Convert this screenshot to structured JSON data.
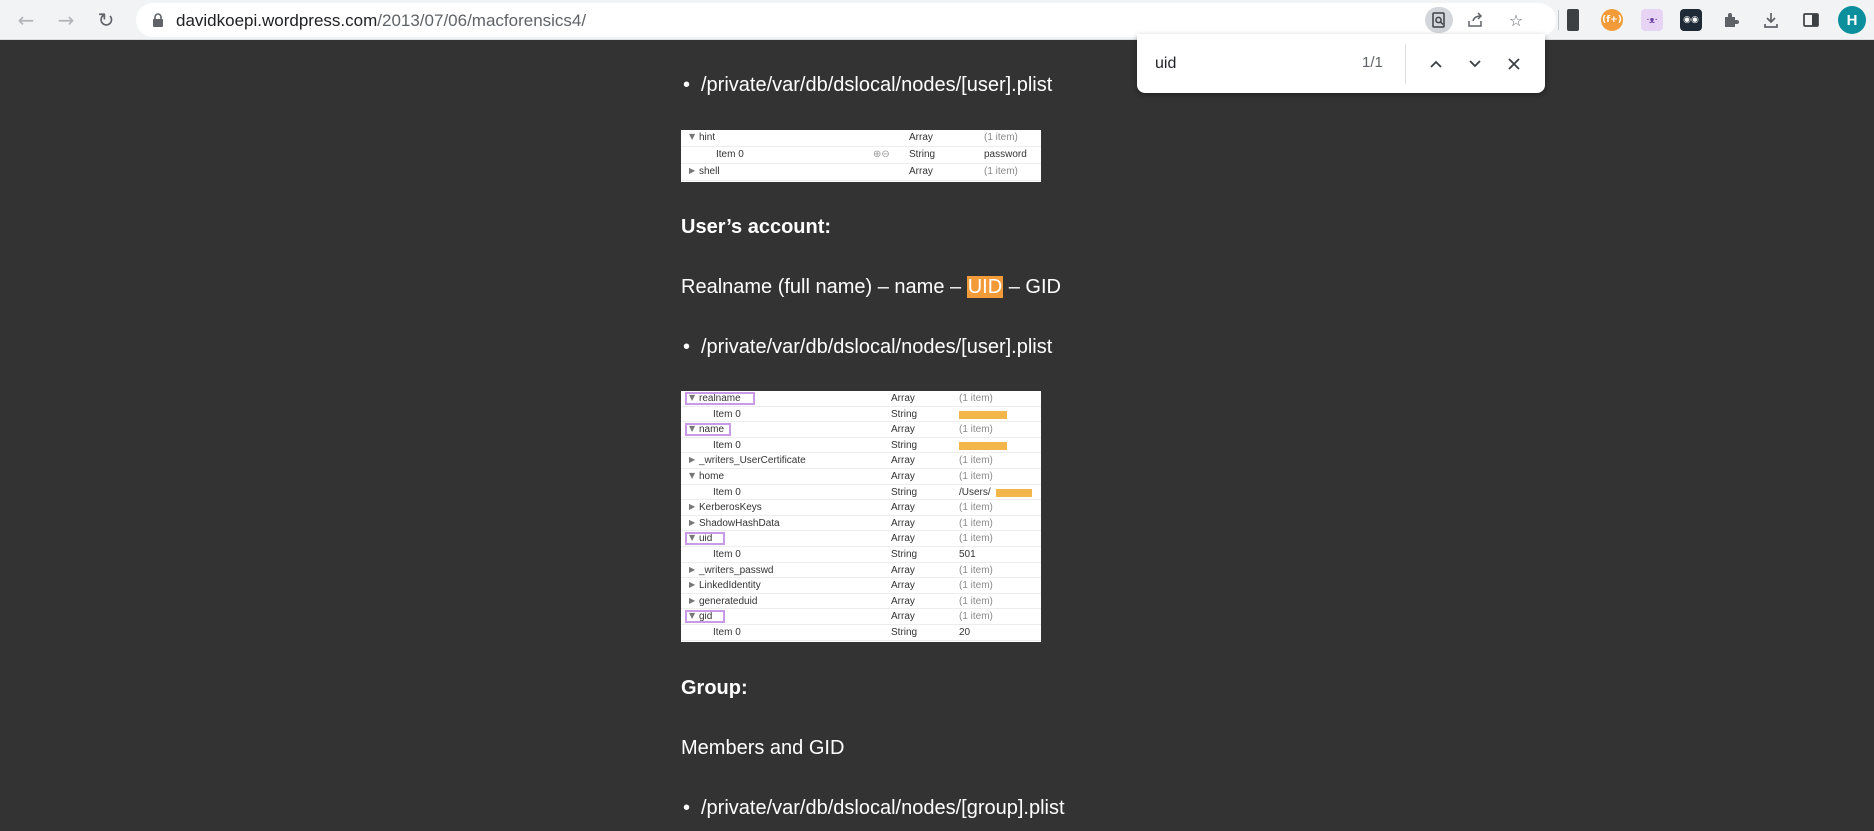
{
  "browser": {
    "url_host": "davidkoepi.wordpress.com",
    "url_path": "/2013/07/06/macforensics4/",
    "avatar_letter": "H",
    "nav_icons": [
      "back-arrow-icon",
      "forward-arrow-icon",
      "reload-icon"
    ],
    "ext_icon_2_label": "(f+)"
  },
  "findbar": {
    "query": "uid",
    "count": "1/1"
  },
  "article": {
    "bullet1": "/private/var/db/dslocal/nodes/[user].plist",
    "plist1": [
      {
        "key": "hint",
        "type": "Array",
        "value": "(1 item)"
      },
      {
        "key": "Item 0",
        "type": "String",
        "value": "password"
      },
      {
        "key": "shell",
        "type": "Array",
        "value": "(1 item)"
      }
    ],
    "heading_account": "User’s account:",
    "account_para_before": "Realname (full name) – name – ",
    "account_para_highlight": "UID",
    "account_para_after": " – GID",
    "bullet2": "/private/var/db/dslocal/nodes/[user].plist",
    "plist2": [
      {
        "key": "realname",
        "type": "Array",
        "value": "(1 item)"
      },
      {
        "key": "Item 0",
        "type": "String",
        "value": ""
      },
      {
        "key": "name",
        "type": "Array",
        "value": "(1 item)"
      },
      {
        "key": "Item 0",
        "type": "String",
        "value": ""
      },
      {
        "key": "_writers_UserCertificate",
        "type": "Array",
        "value": "(1 item)"
      },
      {
        "key": "home",
        "type": "Array",
        "value": "(1 item)"
      },
      {
        "key": "Item 0",
        "type": "String",
        "value": "/Users/"
      },
      {
        "key": "KerberosKeys",
        "type": "Array",
        "value": "(1 item)"
      },
      {
        "key": "ShadowHashData",
        "type": "Array",
        "value": "(1 item)"
      },
      {
        "key": "uid",
        "type": "Array",
        "value": "(1 item)"
      },
      {
        "key": "Item 0",
        "type": "String",
        "value": "501"
      },
      {
        "key": "_writers_passwd",
        "type": "Array",
        "value": "(1 item)"
      },
      {
        "key": "LinkedIdentity",
        "type": "Array",
        "value": "(1 item)"
      },
      {
        "key": "generateduid",
        "type": "Array",
        "value": "(1 item)"
      },
      {
        "key": "gid",
        "type": "Array",
        "value": "(1 item)"
      },
      {
        "key": "Item 0",
        "type": "String",
        "value": "20"
      }
    ],
    "heading_group": "Group:",
    "group_para": "Members and GID",
    "bullet3": "/private/var/db/dslocal/nodes/[group].plist"
  },
  "colors": {
    "page_bg": "#333333",
    "highlight": "#f29b38",
    "redaction": "#f3b64a",
    "annotation_box": "#c99be6",
    "avatar": "#0b8f9c"
  }
}
